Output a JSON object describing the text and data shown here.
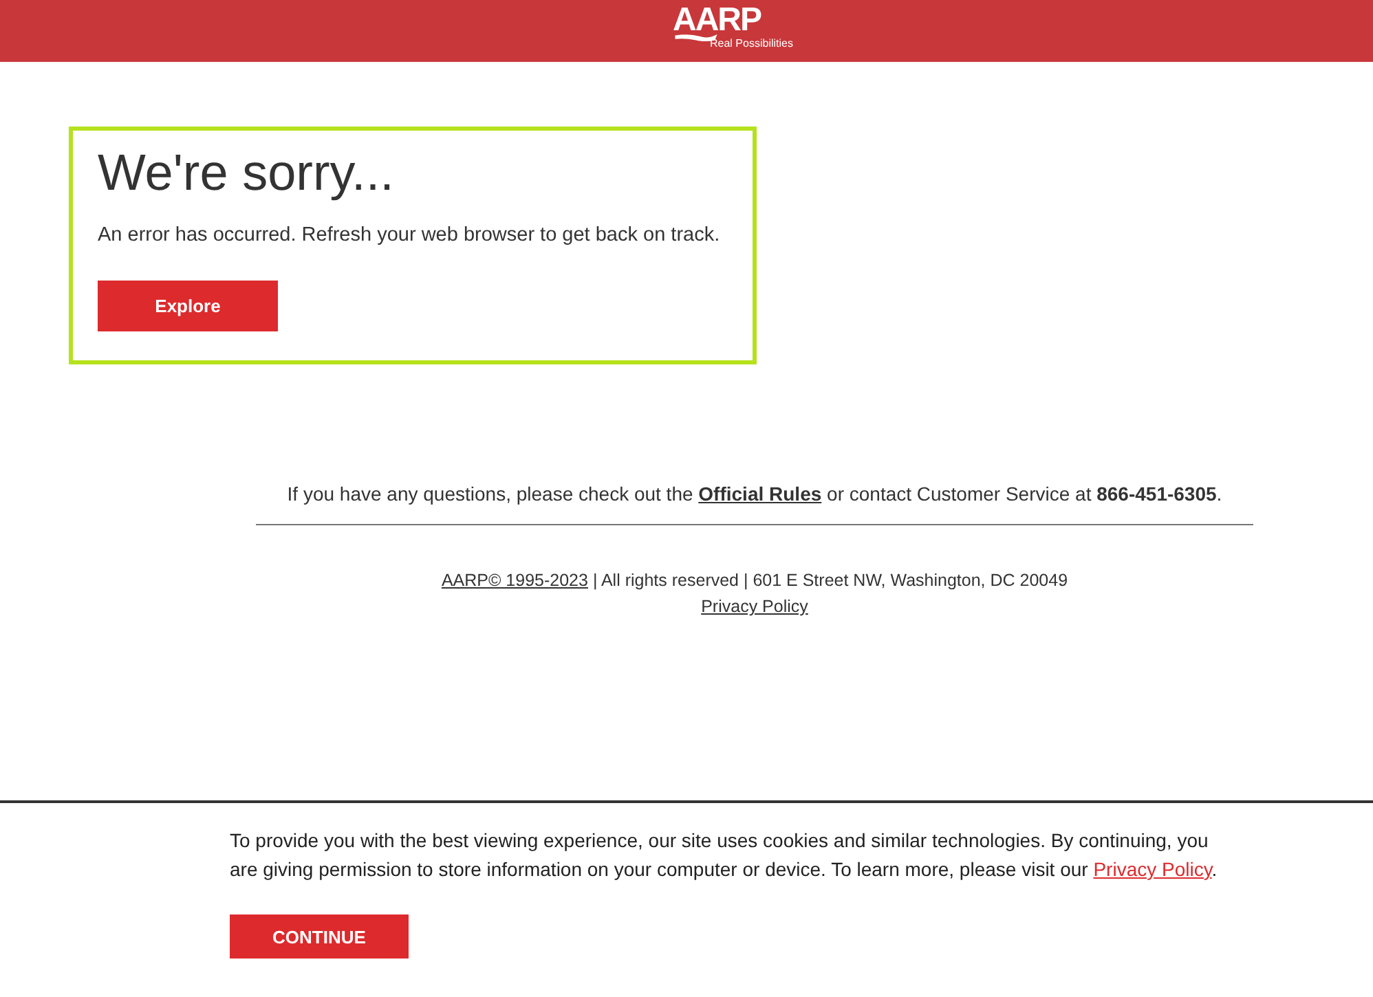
{
  "header": {
    "logo": "AARP",
    "tagline": "Real Possibilities"
  },
  "error": {
    "title": "We're sorry...",
    "message": "An error has occurred. Refresh your web browser to get back on track.",
    "button": "Explore"
  },
  "contact": {
    "before": "If you have any questions, please check out the ",
    "link": "Official Rules",
    "after": " or contact Customer Service at **866-451-6305**."
  },
  "footer": {
    "copyright_link": "AARP© 1995-2023",
    "address": " | All rights reserved | 601 E Street NW, Washington, DC 20049",
    "privacy_link": "Privacy Policy"
  },
  "cookie_banner": {
    "text": "To provide you with the best viewing experience, our site uses cookies and similar technologies. By continuing, you are giving permission to store information on your computer or device. To learn more, please visit our ",
    "link": "Privacy Policy",
    "after": ".",
    "button": "CONTINUE"
  }
}
